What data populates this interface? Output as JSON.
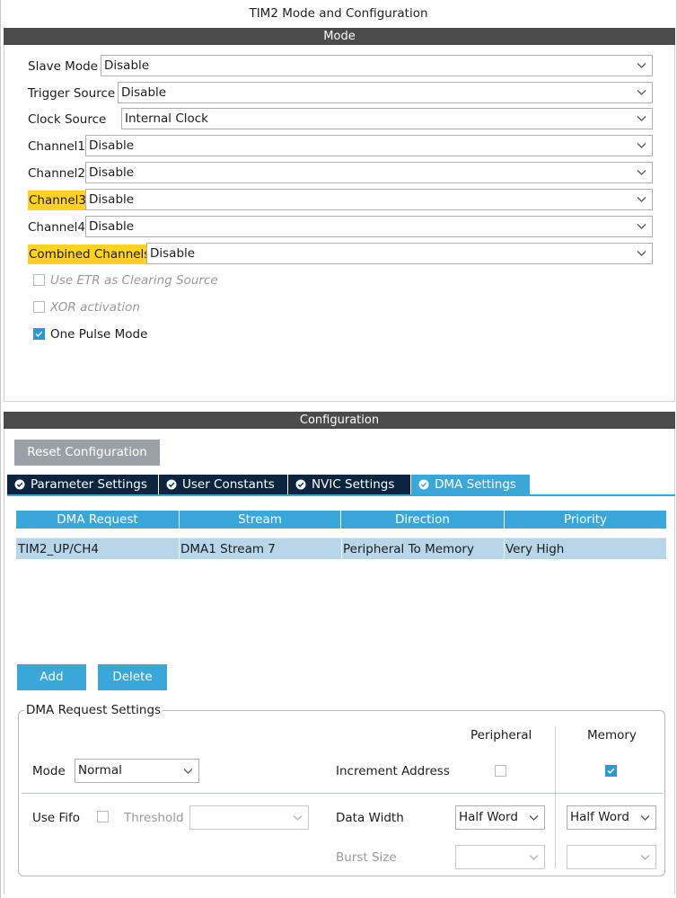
{
  "window": {
    "title": "TIM2 Mode and Configuration"
  },
  "mode": {
    "header": "Mode",
    "rows": [
      {
        "label": "Slave Mode",
        "value": "Disable"
      },
      {
        "label": "Trigger Source",
        "value": "Disable"
      },
      {
        "label": "Clock Source",
        "value": "Internal Clock"
      },
      {
        "label": "Channel1",
        "value": "Disable"
      },
      {
        "label": "Channel2",
        "value": "Disable"
      },
      {
        "label": "Channel3",
        "value": "Disable",
        "highlighted": true
      },
      {
        "label": "Channel4",
        "value": "Disable"
      },
      {
        "label": "Combined Channels",
        "value": "Disable",
        "highlighted": true
      }
    ],
    "checkboxes": [
      {
        "label": "Use ETR as Clearing Source",
        "checked": false,
        "enabled": false
      },
      {
        "label": "XOR activation",
        "checked": false,
        "enabled": false
      },
      {
        "label": "One Pulse Mode",
        "checked": true,
        "enabled": true
      }
    ],
    "highlight_color": "#ffd21f"
  },
  "configuration": {
    "header": "Configuration",
    "reset_label": "Reset Configuration",
    "tabs": [
      {
        "label": "Parameter Settings",
        "icon": "check-circle-icon",
        "active": false
      },
      {
        "label": "User Constants",
        "icon": "check-circle-icon",
        "active": false
      },
      {
        "label": "NVIC Settings",
        "icon": "check-circle-icon",
        "active": false
      },
      {
        "label": "DMA Settings",
        "icon": "check-circle-icon",
        "active": true
      }
    ],
    "dma_table": {
      "columns": [
        "DMA Request",
        "Stream",
        "Direction",
        "Priority"
      ],
      "rows": [
        [
          "TIM2_UP/CH4",
          "DMA1 Stream 7",
          "Peripheral To Memory",
          "Very High"
        ]
      ]
    },
    "add_label": "Add",
    "delete_label": "Delete",
    "request_settings": {
      "legend": "DMA Request Settings",
      "peripheral_header": "Peripheral",
      "memory_header": "Memory",
      "mode_label": "Mode",
      "mode_value": "Normal",
      "increment_label": "Increment Address",
      "increment_peripheral": false,
      "increment_memory": true,
      "use_fifo_label": "Use Fifo",
      "use_fifo": false,
      "threshold_label": "Threshold",
      "threshold_value": "",
      "data_width_label": "Data Width",
      "data_width_peripheral": "Half Word",
      "data_width_memory": "Half Word",
      "burst_size_label": "Burst Size",
      "burst_peripheral": "",
      "burst_memory": ""
    }
  },
  "colors": {
    "accent": "#3aa7db",
    "header_bar": "#4b4b4b",
    "tab_inactive": "#0b2440",
    "selected_row": "#b8d6ea",
    "checkbox_checked": "#2a98d4",
    "reset_button": "#9aa1a6"
  }
}
